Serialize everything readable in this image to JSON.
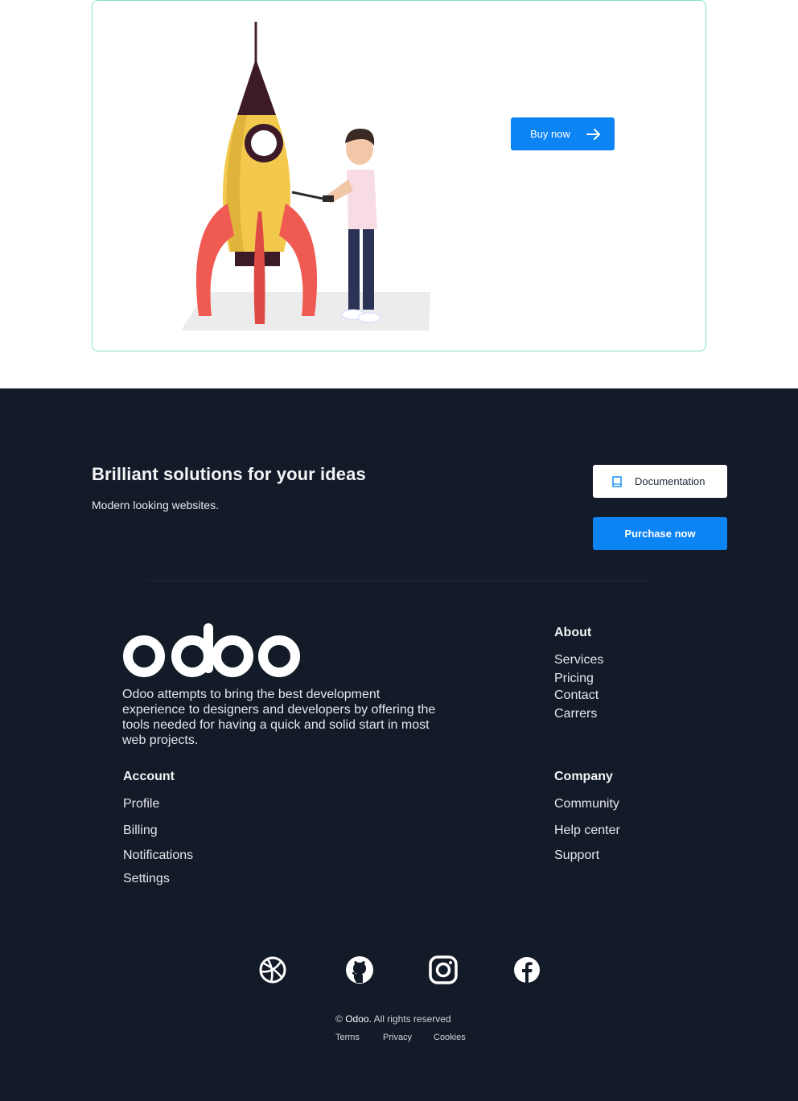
{
  "hero": {
    "buy_label": "Buy now",
    "buy_icon": "arrow-right-icon",
    "illustration": "rocket-and-person-illustration"
  },
  "cta": {
    "title": "Brilliant solutions for your ideas",
    "subtitle": "Modern looking websites.",
    "documentation_label": "Documentation",
    "documentation_icon": "book-icon",
    "purchase_label": "Purchase now"
  },
  "brand": {
    "logo_text": "odoo",
    "description": "Odoo attempts to bring the best development experience to designers and developers by offering the tools needed for having a quick and solid start in most web projects."
  },
  "columns": {
    "about": {
      "title": "About",
      "links": [
        "Services",
        "Pricing",
        "Contact",
        "Carrers"
      ]
    },
    "account": {
      "title": "Account",
      "links": [
        "Profile",
        "Billing",
        "Notifications",
        "Settings"
      ]
    },
    "company": {
      "title": "Company",
      "links": [
        "Community",
        "Help center",
        "Support"
      ]
    }
  },
  "social": [
    "dribbble-icon",
    "github-icon",
    "instagram-icon",
    "facebook-icon"
  ],
  "copyright": {
    "symbol": "©",
    "brand": "Odoo.",
    "text": "All rights reserved"
  },
  "legal": [
    "Terms",
    "Privacy",
    "Cookies"
  ],
  "colors": {
    "accent": "#0d84f4",
    "footer_bg": "#131a28",
    "card_border": "#7fe3c6"
  }
}
